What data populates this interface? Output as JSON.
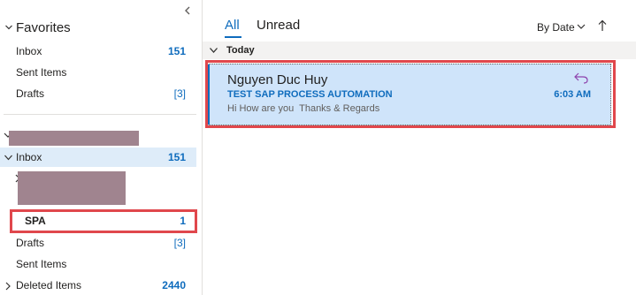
{
  "favorites": {
    "title": "Favorites",
    "items": [
      {
        "label": "Inbox",
        "count": "151"
      },
      {
        "label": "Sent Items",
        "count": ""
      },
      {
        "label": "Drafts",
        "count": "[3]"
      }
    ]
  },
  "mailbox": {
    "inbox": {
      "label": "Inbox",
      "count": "151"
    },
    "spa": {
      "label": "SPA",
      "count": "1"
    },
    "drafts": {
      "label": "Drafts",
      "count": "[3]"
    },
    "sent": {
      "label": "Sent Items"
    },
    "deleted": {
      "label": "Deleted Items",
      "count": "2440"
    }
  },
  "list": {
    "tabs": {
      "all": "All",
      "unread": "Unread"
    },
    "sort_label": "By Date",
    "group_label": "Today",
    "message": {
      "sender": "Nguyen Duc Huy",
      "subject": "TEST SAP PROCESS AUTOMATION",
      "time": "6:03 AM",
      "preview": "Hi How are you  Thanks & Regards"
    }
  },
  "colors": {
    "accent": "#0f6cbd",
    "selected_bg": "#cfe4fa",
    "highlight_box": "#e0474c",
    "redaction": "#a0848f"
  },
  "icons": {
    "collapse": "chevron-left-icon",
    "reply": "reply-icon",
    "sort_direction": "arrow-up-icon"
  }
}
